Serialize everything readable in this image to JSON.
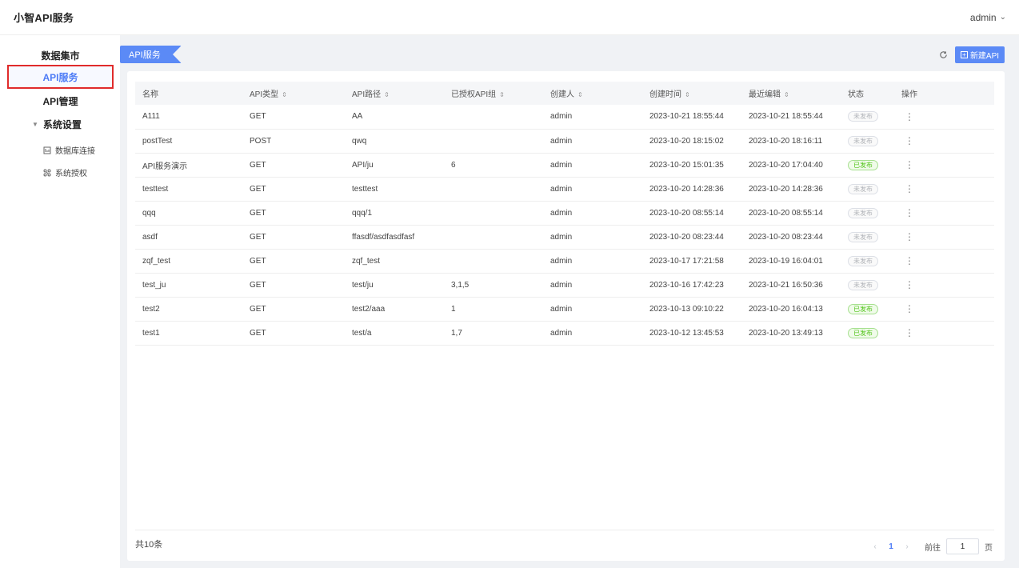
{
  "header": {
    "app_title": "小智API服务",
    "user": "admin"
  },
  "sidebar": {
    "items": [
      {
        "label": "数据集市"
      },
      {
        "label": "API服务"
      },
      {
        "label": "API管理"
      }
    ],
    "group": {
      "label": "系统设置",
      "children": [
        {
          "label": "数据库连接"
        },
        {
          "label": "系统授权"
        }
      ]
    }
  },
  "toolbar": {
    "tab_label": "API服务",
    "new_label": "新建API"
  },
  "table": {
    "columns": [
      "名称",
      "API类型",
      "API路径",
      "已授权API组",
      "创建人",
      "创建时间",
      "最近编辑",
      "状态",
      "操作"
    ],
    "rows": [
      {
        "name": "A111",
        "type": "GET",
        "path": "AA",
        "groups": "",
        "creator": "admin",
        "created": "2023-10-21 18:55:44",
        "edited": "2023-10-21 18:55:44",
        "status": "未发布"
      },
      {
        "name": "postTest",
        "type": "POST",
        "path": "qwq",
        "groups": "",
        "creator": "admin",
        "created": "2023-10-20 18:15:02",
        "edited": "2023-10-20 18:16:11",
        "status": "未发布"
      },
      {
        "name": "API服务演示",
        "type": "GET",
        "path": "API/ju",
        "groups": "6",
        "creator": "admin",
        "created": "2023-10-20 15:01:35",
        "edited": "2023-10-20 17:04:40",
        "status": "已发布"
      },
      {
        "name": "testtest",
        "type": "GET",
        "path": "testtest",
        "groups": "",
        "creator": "admin",
        "created": "2023-10-20 14:28:36",
        "edited": "2023-10-20 14:28:36",
        "status": "未发布"
      },
      {
        "name": "qqq",
        "type": "GET",
        "path": "qqq/1",
        "groups": "",
        "creator": "admin",
        "created": "2023-10-20 08:55:14",
        "edited": "2023-10-20 08:55:14",
        "status": "未发布"
      },
      {
        "name": "asdf",
        "type": "GET",
        "path": "ffasdf/asdfasdfasf",
        "groups": "",
        "creator": "admin",
        "created": "2023-10-20 08:23:44",
        "edited": "2023-10-20 08:23:44",
        "status": "未发布"
      },
      {
        "name": "zqf_test",
        "type": "GET",
        "path": "zqf_test",
        "groups": "",
        "creator": "admin",
        "created": "2023-10-17 17:21:58",
        "edited": "2023-10-19 16:04:01",
        "status": "未发布"
      },
      {
        "name": "test_ju",
        "type": "GET",
        "path": "test/ju",
        "groups": "3,1,5",
        "creator": "admin",
        "created": "2023-10-16 17:42:23",
        "edited": "2023-10-21 16:50:36",
        "status": "未发布"
      },
      {
        "name": "test2",
        "type": "GET",
        "path": "test2/aaa",
        "groups": "1",
        "creator": "admin",
        "created": "2023-10-13 09:10:22",
        "edited": "2023-10-20 16:04:13",
        "status": "已发布"
      },
      {
        "name": "test1",
        "type": "GET",
        "path": "test/a",
        "groups": "1,7",
        "creator": "admin",
        "created": "2023-10-12 13:45:53",
        "edited": "2023-10-20 13:49:13",
        "status": "已发布"
      }
    ]
  },
  "pagination": {
    "total_label": "共10条",
    "current_page": "1",
    "goto_label": "前往",
    "goto_value": "1",
    "page_suffix": "页"
  },
  "colors": {
    "accent": "#5b8af6",
    "published": "#52c41a",
    "highlight_border": "#e02b2b"
  }
}
